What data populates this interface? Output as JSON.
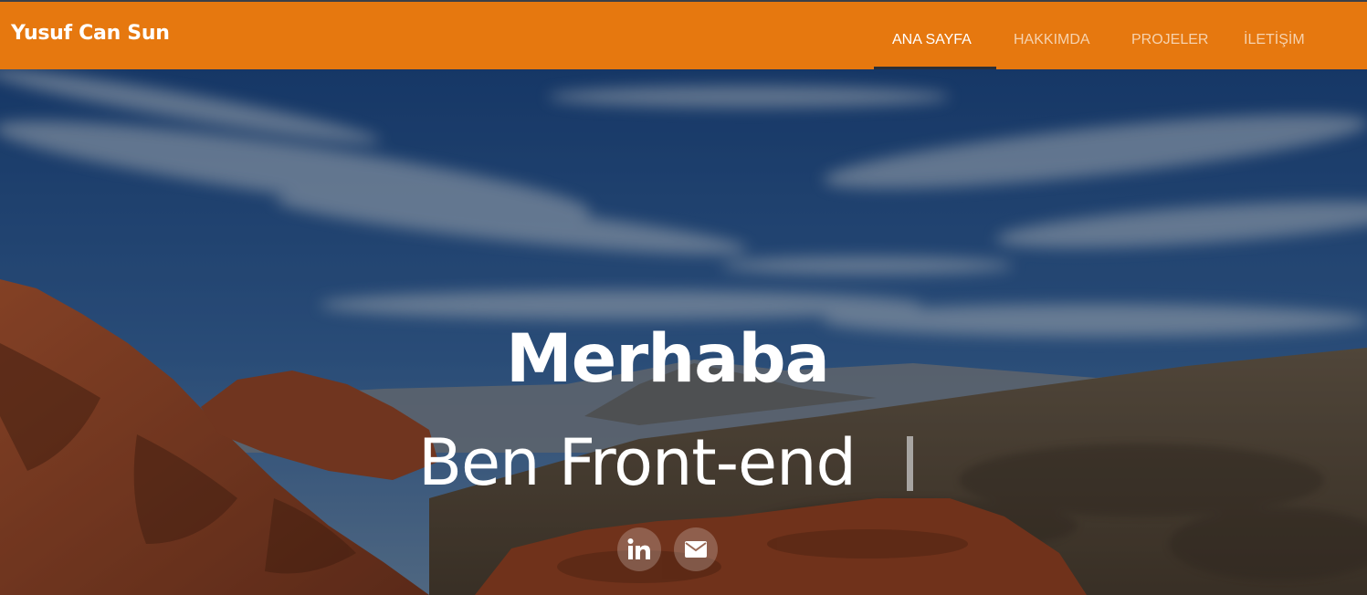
{
  "navbar": {
    "brand": "Yusuf Can Sun",
    "items": [
      {
        "label": "ANA SAYFA",
        "active": true
      },
      {
        "label": "HAKKIMDA",
        "active": false
      },
      {
        "label": "PROJELER",
        "active": false
      },
      {
        "label": "İLETİŞİM",
        "active": false
      }
    ],
    "background_color": "#e6780f"
  },
  "hero": {
    "title": "Merhaba",
    "subtitle": "Ben Front-end",
    "social": [
      {
        "icon": "linkedin-icon",
        "label": "in"
      },
      {
        "icon": "mail-icon"
      }
    ]
  }
}
